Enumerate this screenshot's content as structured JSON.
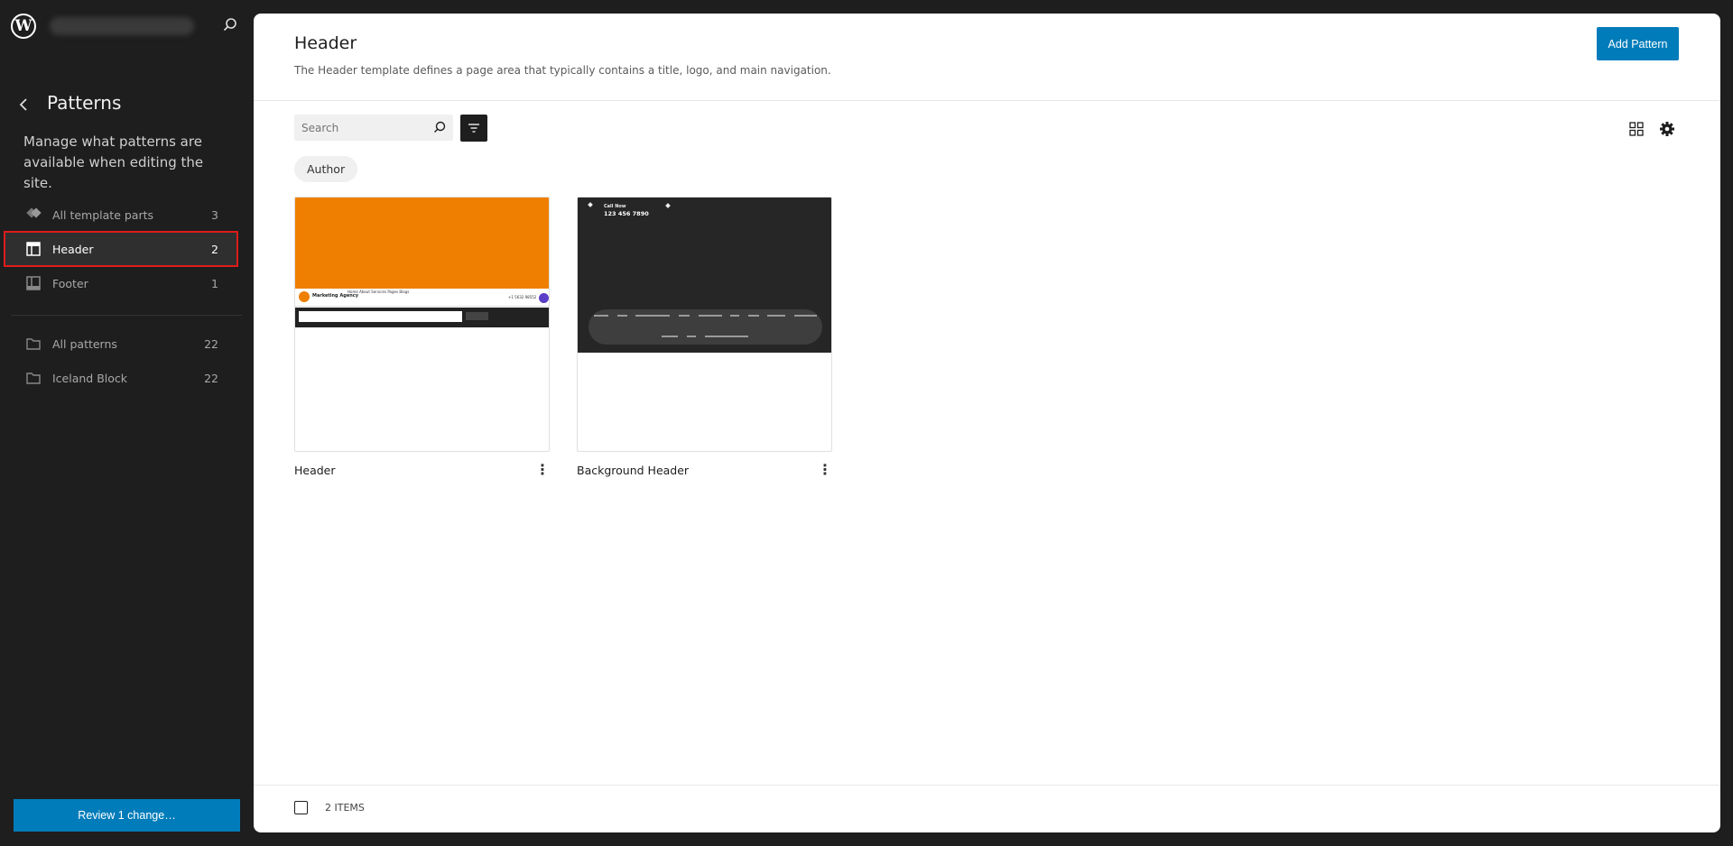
{
  "sidebar": {
    "title": "Patterns",
    "description": "Manage what patterns are available when editing the site.",
    "template_parts": [
      {
        "label": "All template parts",
        "count": "3",
        "icon": "template-parts-icon"
      },
      {
        "label": "Header",
        "count": "2",
        "icon": "header-icon",
        "active": true
      },
      {
        "label": "Footer",
        "count": "1",
        "icon": "footer-icon"
      }
    ],
    "categories": [
      {
        "label": "All patterns",
        "count": "22",
        "icon": "folder-icon"
      },
      {
        "label": "Iceland Block",
        "count": "22",
        "icon": "folder-icon"
      }
    ],
    "review_button": "Review 1 change…"
  },
  "main": {
    "title": "Header",
    "description": "The Header template defines a page area that typically contains a title, logo, and main navigation.",
    "add_button": "Add Pattern",
    "search_placeholder": "Search",
    "author_chip": "Author",
    "cards": [
      {
        "title": "Header"
      },
      {
        "title": "Background Header"
      }
    ],
    "thumb1": {
      "brand": "Marketing Agency",
      "nav": "Home   About   Services   Pages   Blogs",
      "phone": "+1 5632 98552"
    },
    "thumb2": {
      "call_label": "Call Now",
      "phone": "123 456 7890"
    },
    "footer_count": "2 ITEMS"
  },
  "colors": {
    "accent": "#007cba",
    "sidebar_bg": "#1e1e1e",
    "highlight_outline": "#e01b1b",
    "thumb_orange": "#ef7f00"
  }
}
